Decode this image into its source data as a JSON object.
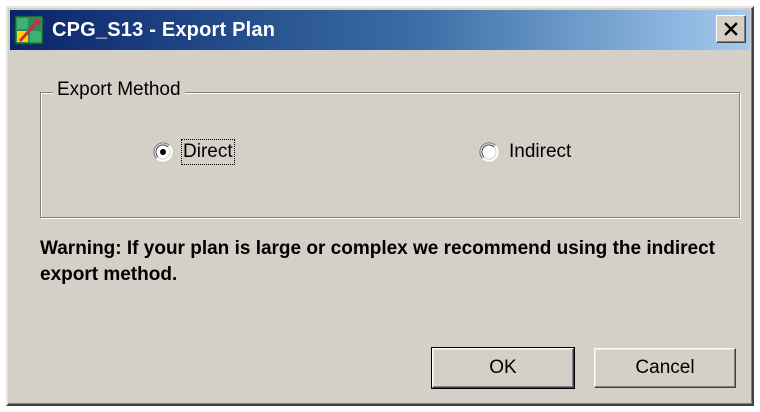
{
  "window": {
    "title": "CPG_S13 - Export Plan",
    "app_icon": "app-icon",
    "close_glyph": "✕"
  },
  "export_method": {
    "legend": "Export Method",
    "options": [
      {
        "label": "Direct",
        "selected": true,
        "focused": true
      },
      {
        "label": "Indirect",
        "selected": false,
        "focused": false
      }
    ]
  },
  "warning_text": "Warning: If your plan is large or complex we recommend using the indirect export method.",
  "buttons": {
    "ok_label": "OK",
    "cancel_label": "Cancel"
  },
  "colors": {
    "dialog_face": "#d4d0c8",
    "titlebar_start": "#0a246a",
    "titlebar_end": "#a6caf0",
    "title_text": "#ffffff"
  }
}
